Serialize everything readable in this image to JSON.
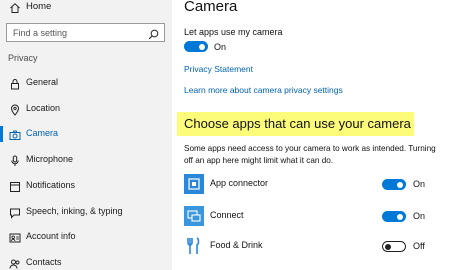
{
  "sidebar": {
    "home_label": "Home",
    "search_placeholder": "Find a setting",
    "section_title": "Privacy",
    "items": [
      {
        "label": "General",
        "icon": "general-lock-icon"
      },
      {
        "label": "Location",
        "icon": "location-pin-icon"
      },
      {
        "label": "Camera",
        "icon": "camera-icon",
        "active": true
      },
      {
        "label": "Microphone",
        "icon": "microphone-icon"
      },
      {
        "label": "Notifications",
        "icon": "notifications-icon"
      },
      {
        "label": "Speech, inking, & typing",
        "icon": "speech-icon"
      },
      {
        "label": "Account info",
        "icon": "account-info-icon"
      },
      {
        "label": "Contacts",
        "icon": "contacts-icon"
      }
    ]
  },
  "main": {
    "title": "Camera",
    "let_apps_label": "Let apps use my camera",
    "let_apps_state": "On",
    "privacy_statement_link": "Privacy Statement",
    "learn_more_link": "Learn more about camera privacy settings",
    "choose_heading": "Choose apps that can use your camera",
    "description": "Some apps need access to your camera to work as intended. Turning off an app here might limit what it can do.",
    "apps": [
      {
        "name": "App connector",
        "state": "On",
        "on": true,
        "icon": "app-connector-icon"
      },
      {
        "name": "Connect",
        "state": "On",
        "on": true,
        "icon": "connect-icon"
      },
      {
        "name": "Food & Drink",
        "state": "Off",
        "on": false,
        "icon": "food-drink-icon"
      }
    ]
  },
  "colors": {
    "accent": "#0078d7",
    "link": "#0063b1",
    "highlight": "#fdfb7a",
    "sidebar_bg": "#f2f2f2"
  }
}
